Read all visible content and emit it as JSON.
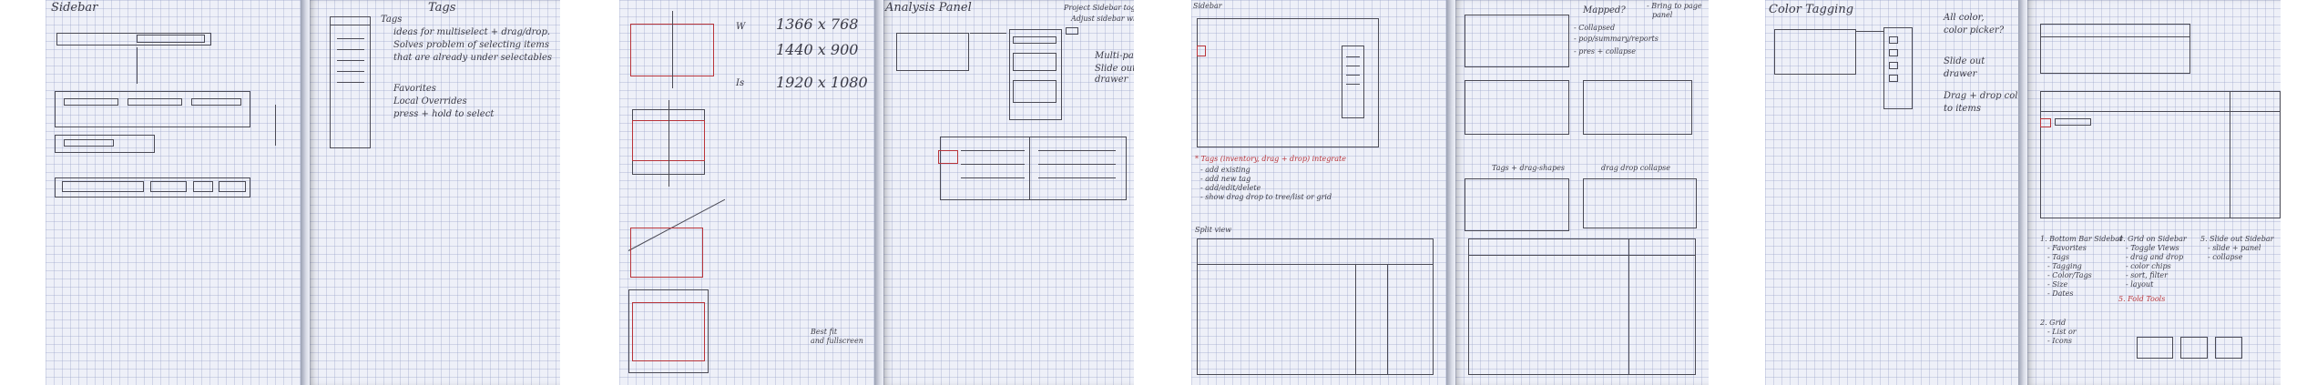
{
  "spreads": [
    {
      "left_title": "Sidebar",
      "right_title": "Tags",
      "tags_notes": [
        "ideas for multiselect + drag/drop.",
        "Solves problem of selecting items",
        "that are already under selectables"
      ],
      "tags_list": [
        "Favorites",
        "Local Overrides",
        "press + hold to select"
      ],
      "heading_mark": "Tags"
    },
    {
      "resolutions": [
        "1366 x 768",
        "1440 x 900",
        "1920 x 1080"
      ],
      "res_labels": [
        "W",
        "",
        "Is"
      ],
      "right_title": "Analysis Panel",
      "right_notes": [
        "Project Sidebar toggled",
        "Adjust sidebar width"
      ],
      "pane_notes": [
        "Multi-pane",
        "Slide out",
        "drawer"
      ],
      "bottom_note": [
        "Best fit",
        "and fullscreen"
      ]
    },
    {
      "left_title": "Sidebar",
      "tag_notes": [
        "* Tags (inventory, drag + drop) integrate",
        "- add existing",
        "- add new tag",
        "- add/edit/delete",
        "- show drag drop to tree/list or grid"
      ],
      "left_sub": "Split view",
      "right_title": "Mapped?",
      "right_notes": [
        "- Bring to page",
        "panel",
        "- Collapsed",
        "- pop/summary/reports",
        "- pres + collapse"
      ],
      "right_mid": [
        "Tags + drag-shapes",
        "drag drop collapse"
      ]
    },
    {
      "left_title": "Color Tagging",
      "left_notes": [
        "All color,",
        "color picker?",
        "Slide out",
        "drawer",
        "Drag + drop color",
        "to items"
      ],
      "bottom_notes_a": [
        "1. Bottom Bar Sidebar",
        "- Favorites",
        "- Tags",
        "- Tagging",
        "- Color/Tags",
        "- Size",
        "- Dates"
      ],
      "bottom_notes_b": [
        "4. Grid on Sidebar",
        "- Toggle Views",
        "- drag and drop",
        "- color chips",
        "- sort, filter",
        "- layout",
        "5. Fold Tools"
      ],
      "bottom_notes_c": [
        "5. Slide out Sidebar",
        "- slide + panel",
        "- collapse"
      ],
      "bottom_notes_d": [
        "2. Grid",
        "- List or",
        "- Icons"
      ]
    }
  ]
}
